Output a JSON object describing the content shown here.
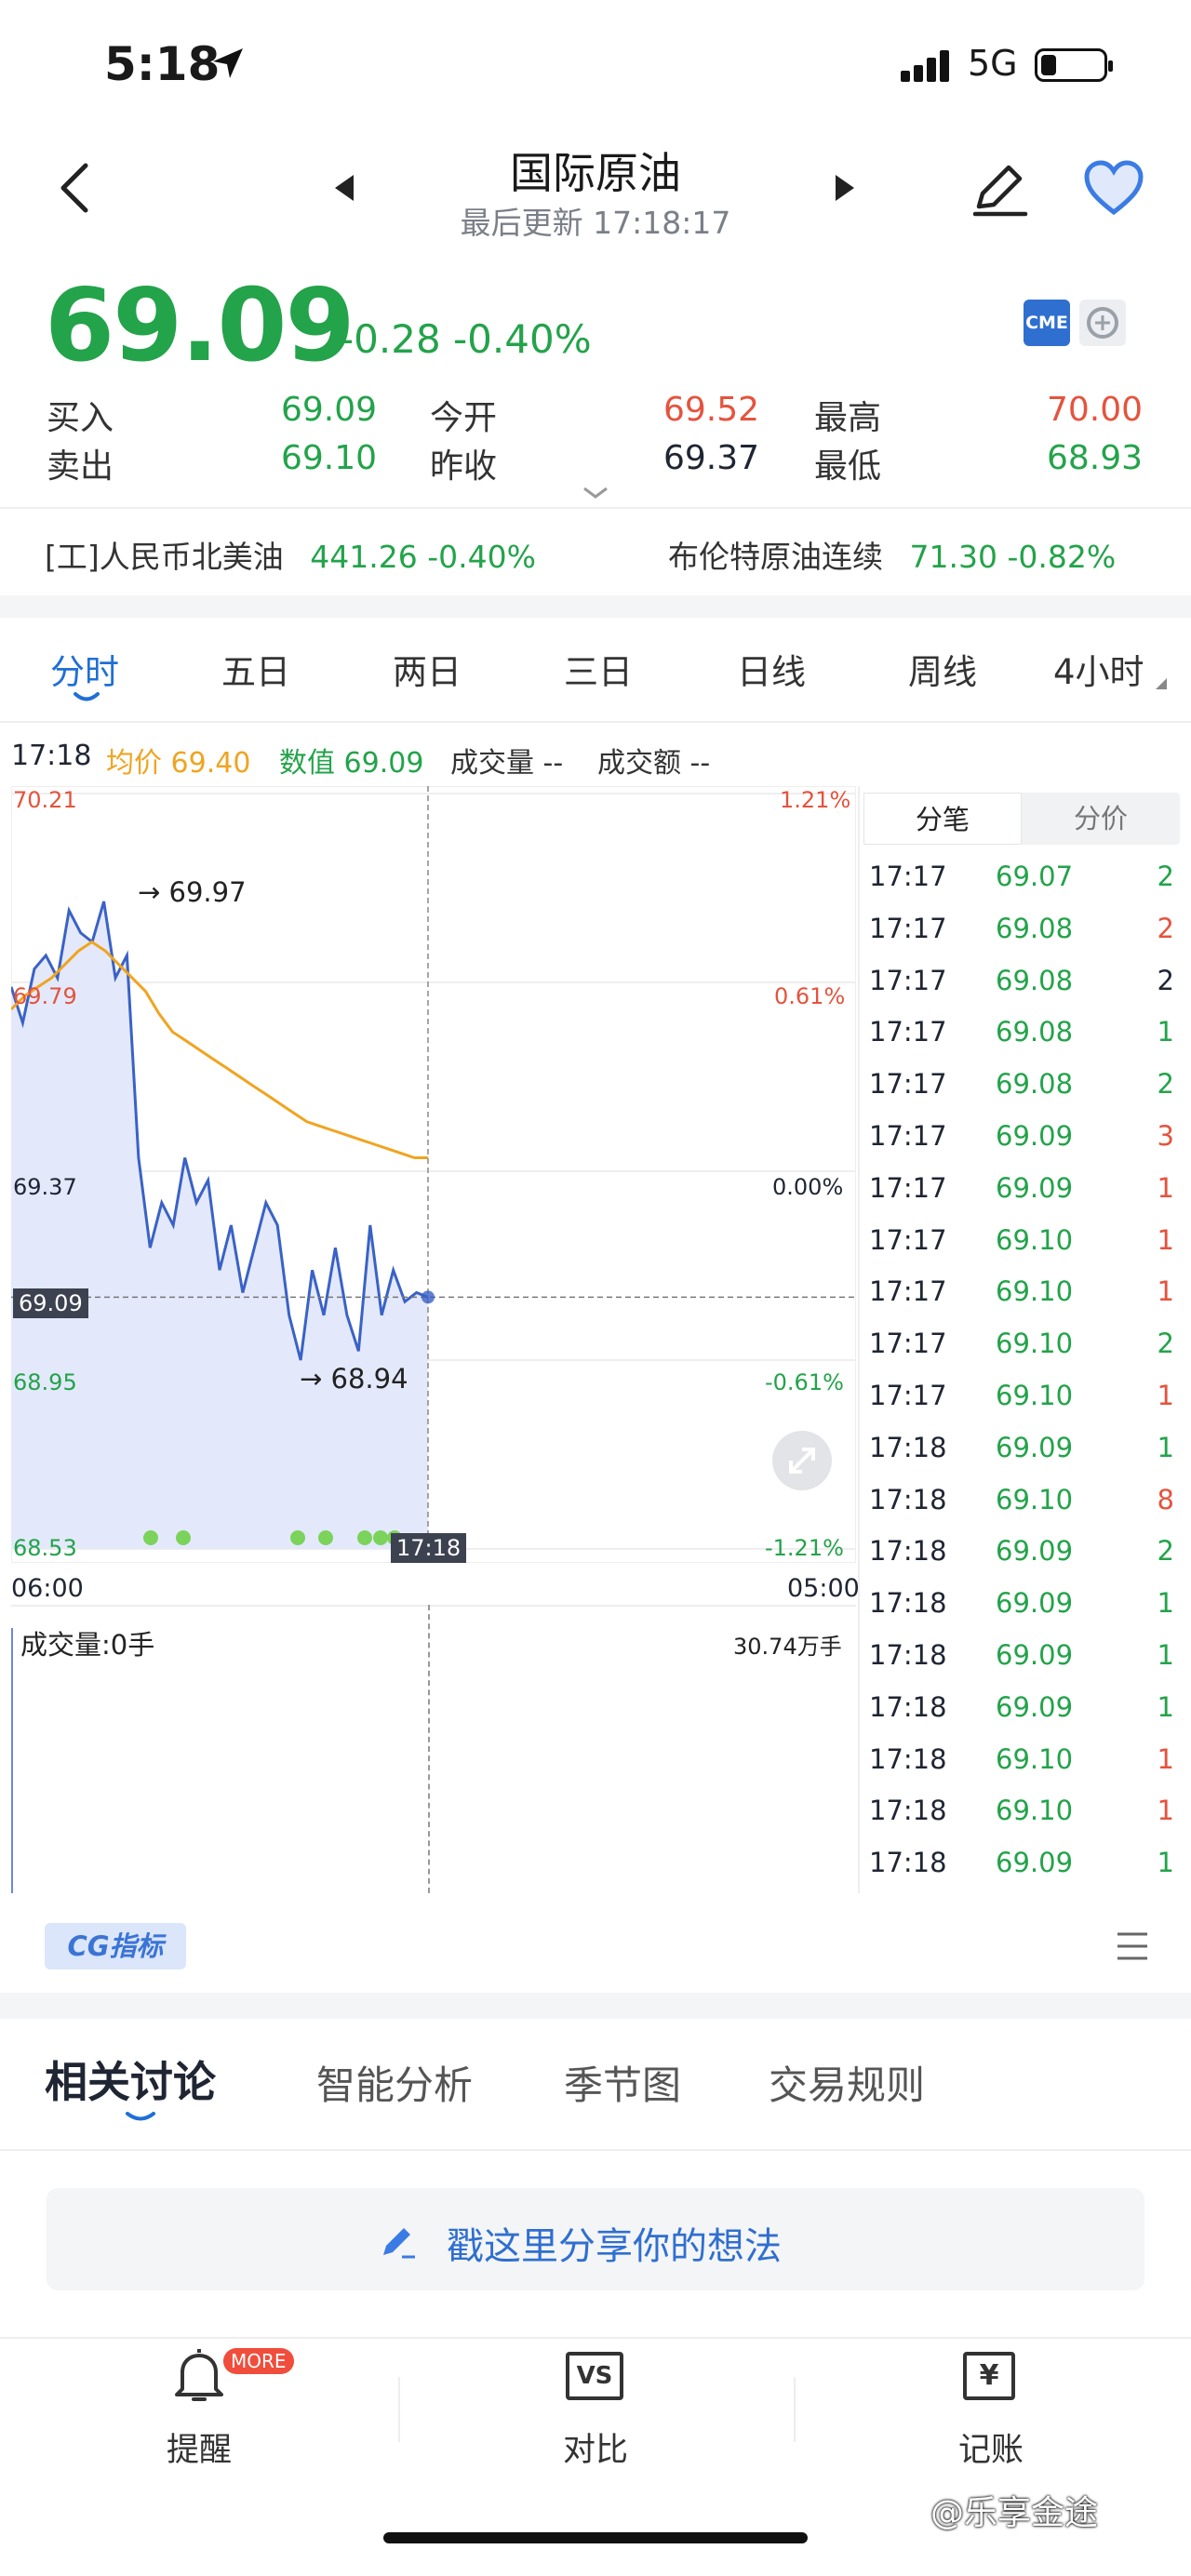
{
  "status_bar": {
    "time": "5:18",
    "network": "5G"
  },
  "header": {
    "title": "国际原油",
    "updated": "最后更新 17:18:17"
  },
  "quote": {
    "price": "69.09",
    "change": "-0.28 -0.40%",
    "badges": [
      "CME"
    ],
    "buy_label": "买入",
    "buy": "69.09",
    "sell_label": "卖出",
    "sell": "69.10",
    "open_label": "今开",
    "open": "69.52",
    "prev_label": "昨收",
    "prev": "69.37",
    "high_label": "最高",
    "high": "70.00",
    "low_label": "最低",
    "low": "68.93"
  },
  "related": {
    "r1_name": "[工]人民币北美油",
    "r1_value": "441.26 -0.40%",
    "r2_name": "布伦特原油连续",
    "r2_value": "71.30 -0.82%"
  },
  "tabs": [
    "分时",
    "五日",
    "两日",
    "三日",
    "日线",
    "周线",
    "4小时"
  ],
  "info_bar": {
    "time": "17:18",
    "avg": "均价 69.40",
    "value": "数值 69.09",
    "vol": "成交量 --",
    "amount": "成交额 --"
  },
  "chart_data": {
    "type": "line",
    "y_labels_left": [
      "70.21",
      "69.79",
      "69.37",
      "69.09",
      "68.95",
      "68.53"
    ],
    "y_labels_right": [
      "1.21%",
      "0.61%",
      "0.00%",
      "-0.61%",
      "-1.21%"
    ],
    "x_labels": [
      "06:00",
      "05:00"
    ],
    "cursor_time": "17:18",
    "ylim": [
      68.53,
      70.21
    ],
    "high_marker": "69.97",
    "low_marker": "68.94",
    "series": [
      {
        "values": [
          69.78,
          69.7,
          69.82,
          69.85,
          69.8,
          69.95,
          69.9,
          69.88,
          69.97,
          69.8,
          69.85,
          69.4,
          69.2,
          69.3,
          69.25,
          69.4,
          69.3,
          69.35,
          69.15,
          69.25,
          69.1,
          69.2,
          69.3,
          69.25,
          69.05,
          68.95,
          69.15,
          69.05,
          69.2,
          69.05,
          68.97,
          69.25,
          69.05,
          69.15,
          69.08,
          69.1,
          69.09
        ]
      },
      {
        "values": [
          69.73,
          69.76,
          69.78,
          69.8,
          69.83,
          69.86,
          69.88,
          69.86,
          69.83,
          69.8,
          69.77,
          69.72,
          69.68,
          69.66,
          69.64,
          69.62,
          69.6,
          69.58,
          69.56,
          69.54,
          69.52,
          69.5,
          69.48,
          69.47,
          69.46,
          69.45,
          69.44,
          69.43,
          69.42,
          69.41,
          69.4,
          69.4
        ]
      }
    ]
  },
  "volume": {
    "label": "成交量:0手",
    "max": "30.74万手"
  },
  "trades_tabs": [
    "分笔",
    "分价"
  ],
  "trades": [
    {
      "t": "17:17",
      "p": "69.07",
      "v": "2",
      "c": "#23a34a",
      "vc": "#23a34a"
    },
    {
      "t": "17:17",
      "p": "69.08",
      "v": "2",
      "c": "#23a34a",
      "vc": "#e5533d"
    },
    {
      "t": "17:17",
      "p": "69.08",
      "v": "2",
      "c": "#23a34a",
      "vc": "#1f2533"
    },
    {
      "t": "17:17",
      "p": "69.08",
      "v": "1",
      "c": "#23a34a",
      "vc": "#23a34a"
    },
    {
      "t": "17:17",
      "p": "69.08",
      "v": "2",
      "c": "#23a34a",
      "vc": "#23a34a"
    },
    {
      "t": "17:17",
      "p": "69.09",
      "v": "3",
      "c": "#23a34a",
      "vc": "#e5533d"
    },
    {
      "t": "17:17",
      "p": "69.09",
      "v": "1",
      "c": "#23a34a",
      "vc": "#e5533d"
    },
    {
      "t": "17:17",
      "p": "69.10",
      "v": "1",
      "c": "#23a34a",
      "vc": "#e5533d"
    },
    {
      "t": "17:17",
      "p": "69.10",
      "v": "1",
      "c": "#23a34a",
      "vc": "#e5533d"
    },
    {
      "t": "17:17",
      "p": "69.10",
      "v": "2",
      "c": "#23a34a",
      "vc": "#23a34a"
    },
    {
      "t": "17:17",
      "p": "69.10",
      "v": "1",
      "c": "#23a34a",
      "vc": "#e5533d"
    },
    {
      "t": "17:18",
      "p": "69.09",
      "v": "1",
      "c": "#23a34a",
      "vc": "#23a34a"
    },
    {
      "t": "17:18",
      "p": "69.10",
      "v": "8",
      "c": "#23a34a",
      "vc": "#e5533d"
    },
    {
      "t": "17:18",
      "p": "69.09",
      "v": "2",
      "c": "#23a34a",
      "vc": "#23a34a"
    },
    {
      "t": "17:18",
      "p": "69.09",
      "v": "1",
      "c": "#23a34a",
      "vc": "#23a34a"
    },
    {
      "t": "17:18",
      "p": "69.09",
      "v": "1",
      "c": "#23a34a",
      "vc": "#23a34a"
    },
    {
      "t": "17:18",
      "p": "69.09",
      "v": "1",
      "c": "#23a34a",
      "vc": "#23a34a"
    },
    {
      "t": "17:18",
      "p": "69.10",
      "v": "1",
      "c": "#23a34a",
      "vc": "#e5533d"
    },
    {
      "t": "17:18",
      "p": "69.10",
      "v": "1",
      "c": "#23a34a",
      "vc": "#e5533d"
    },
    {
      "t": "17:18",
      "p": "69.09",
      "v": "1",
      "c": "#23a34a",
      "vc": "#23a34a"
    }
  ],
  "cg_label": "CG指标",
  "discussion_tabs": [
    "相关讨论",
    "智能分析",
    "季节图",
    "交易规则"
  ],
  "share_prompt": "戳这里分享你的想法",
  "bottom_nav": {
    "remind": "提醒",
    "more_badge": "MORE",
    "compare": "对比",
    "compare_icon": "VS",
    "ledger": "记账",
    "ledger_icon": "¥"
  },
  "watermark": "@乐享金途",
  "colors": {
    "green": "#23a34a",
    "red": "#e5533d",
    "blue_line": "#3a62c6",
    "avg_line": "#f0a420",
    "accent": "#1f6fd6"
  }
}
